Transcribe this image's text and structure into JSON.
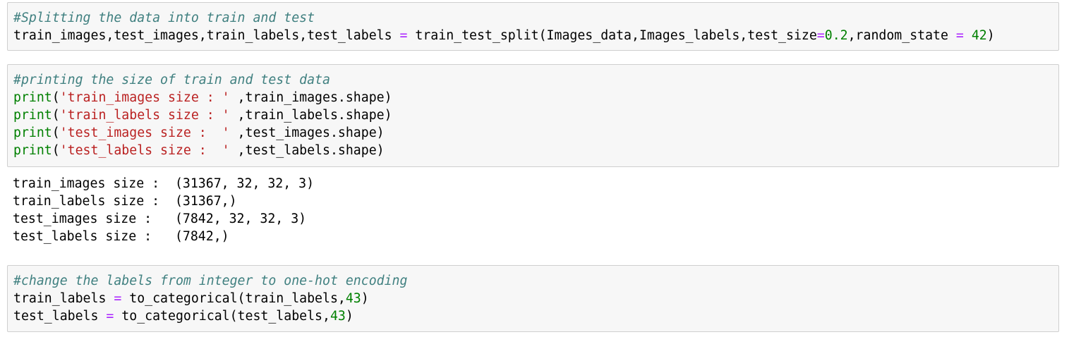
{
  "cells": [
    {
      "lines": [
        [
          {
            "t": "#Splitting the data into train and test",
            "c": "cm"
          }
        ],
        [
          {
            "t": "train_images,test_images,train_labels,test_labels ",
            "c": ""
          },
          {
            "t": "=",
            "c": "op"
          },
          {
            "t": " train_test_split(Images_data,Images_labels,test_size",
            "c": ""
          },
          {
            "t": "=",
            "c": "op"
          },
          {
            "t": "0.2",
            "c": "nm"
          },
          {
            "t": ",random_state ",
            "c": ""
          },
          {
            "t": "=",
            "c": "op"
          },
          {
            "t": " ",
            "c": ""
          },
          {
            "t": "42",
            "c": "nm"
          },
          {
            "t": ")",
            "c": ""
          }
        ]
      ]
    },
    {
      "lines": [
        [
          {
            "t": "#printing the size of train and test data",
            "c": "cm"
          }
        ],
        [
          {
            "t": "print",
            "c": "kw"
          },
          {
            "t": "(",
            "c": ""
          },
          {
            "t": "'train_images size : '",
            "c": "st"
          },
          {
            "t": " ,train_images.shape)",
            "c": ""
          }
        ],
        [
          {
            "t": "print",
            "c": "kw"
          },
          {
            "t": "(",
            "c": ""
          },
          {
            "t": "'train_labels size : '",
            "c": "st"
          },
          {
            "t": " ,train_labels.shape)",
            "c": ""
          }
        ],
        [
          {
            "t": "print",
            "c": "kw"
          },
          {
            "t": "(",
            "c": ""
          },
          {
            "t": "'test_images size :  '",
            "c": "st"
          },
          {
            "t": " ,test_images.shape)",
            "c": ""
          }
        ],
        [
          {
            "t": "print",
            "c": "kw"
          },
          {
            "t": "(",
            "c": ""
          },
          {
            "t": "'test_labels size :  '",
            "c": "st"
          },
          {
            "t": " ,test_labels.shape)",
            "c": ""
          }
        ]
      ]
    },
    {
      "output": true,
      "lines": [
        [
          {
            "t": "train_images size :  (31367, 32, 32, 3)",
            "c": ""
          }
        ],
        [
          {
            "t": "train_labels size :  (31367,)",
            "c": ""
          }
        ],
        [
          {
            "t": "test_images size :   (7842, 32, 32, 3)",
            "c": ""
          }
        ],
        [
          {
            "t": "test_labels size :   (7842,)",
            "c": ""
          }
        ]
      ]
    },
    {
      "lines": [
        [
          {
            "t": "#change the labels from integer to one-hot encoding",
            "c": "cm"
          }
        ],
        [
          {
            "t": "train_labels ",
            "c": ""
          },
          {
            "t": "=",
            "c": "op"
          },
          {
            "t": " to_categorical(train_labels,",
            "c": ""
          },
          {
            "t": "43",
            "c": "nm"
          },
          {
            "t": ")",
            "c": ""
          }
        ],
        [
          {
            "t": "test_labels ",
            "c": ""
          },
          {
            "t": "=",
            "c": "op"
          },
          {
            "t": " to_categorical(test_labels,",
            "c": ""
          },
          {
            "t": "43",
            "c": "nm"
          },
          {
            "t": ")",
            "c": ""
          }
        ]
      ]
    }
  ]
}
